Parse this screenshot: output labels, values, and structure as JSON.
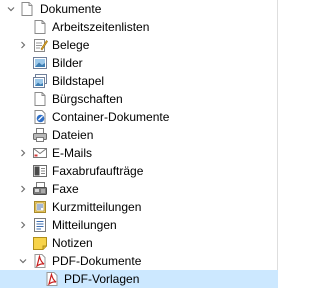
{
  "tree": {
    "root": {
      "label": "Dokumente",
      "expanded": true,
      "icon": "folder-page-icon"
    },
    "items": [
      {
        "label": "Arbeitszeitenlisten",
        "icon": "blank-page-icon",
        "expandable": false
      },
      {
        "label": "Belege",
        "icon": "pencil-note-icon",
        "expandable": true
      },
      {
        "label": "Bilder",
        "icon": "image-icon",
        "expandable": false
      },
      {
        "label": "Bildstapel",
        "icon": "image-stack-icon",
        "expandable": false
      },
      {
        "label": "Bürgschaften",
        "icon": "blank-page-icon",
        "expandable": false
      },
      {
        "label": "Container-Dokumente",
        "icon": "container-document-icon",
        "expandable": false
      },
      {
        "label": "Dateien",
        "icon": "printer-icon",
        "expandable": false
      },
      {
        "label": "E-Mails",
        "icon": "email-icon",
        "expandable": true
      },
      {
        "label": "Faxabrufaufträge",
        "icon": "fax-request-icon",
        "expandable": false
      },
      {
        "label": "Faxe",
        "icon": "fax-icon",
        "expandable": true
      },
      {
        "label": "Kurzmitteilungen",
        "icon": "memo-icon",
        "expandable": false
      },
      {
        "label": "Mitteilungen",
        "icon": "notes-icon",
        "expandable": true
      },
      {
        "label": "Notizen",
        "icon": "sticky-note-icon",
        "expandable": false
      },
      {
        "label": "PDF-Dokumente",
        "icon": "pdf-icon",
        "expandable": true,
        "expanded": true
      },
      {
        "label": "PDF-Vorlagen",
        "icon": "pdf-template-icon",
        "expandable": false,
        "selected": true
      }
    ]
  },
  "colors": {
    "selection": "#cce8ff",
    "pdf_red": "#c8201f",
    "expander": "#6d6d6d"
  }
}
